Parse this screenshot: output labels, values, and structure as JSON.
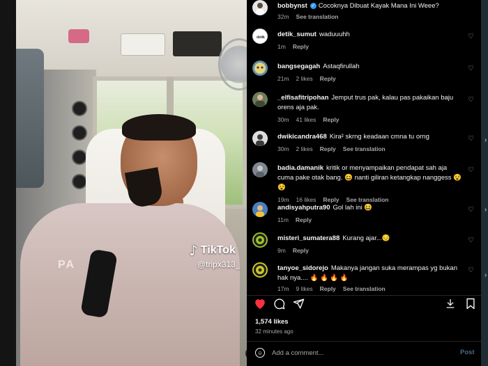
{
  "media": {
    "watermark_brand": "TikTok",
    "watermark_handle": "@tripx313_",
    "shirt_print": "PA",
    "mute_icon": "mute-icon"
  },
  "caption": {
    "username": "bobbynst",
    "text": "Cocoknya Dibuat Kayak Mana Ini Weee?",
    "time": "32m",
    "see_translation": "See translation"
  },
  "comments": [
    {
      "username": "detik_sumut",
      "text": "waduuuhh",
      "time": "1m",
      "likes": "",
      "reply": "Reply",
      "translation": "",
      "avatar_color": "#ffffff"
    },
    {
      "username": "bangsegagah",
      "text": "Astaqfirullah",
      "time": "21m",
      "likes": "2 likes",
      "reply": "Reply",
      "translation": "",
      "avatar_color": "#5f8fb0"
    },
    {
      "username": "_elfisafitripohan",
      "text": "Jemput trus pak, kalau pas pakaikan baju orens aja pak.",
      "time": "30m",
      "likes": "41 likes",
      "reply": "Reply",
      "translation": "",
      "avatar_color": "#6d7d5a"
    },
    {
      "username": "dwikicandra468",
      "text": "Kira² skrng keadaan cmna tu orng",
      "time": "30m",
      "likes": "2 likes",
      "reply": "Reply",
      "translation": "See translation",
      "avatar_color": "#dddddd"
    },
    {
      "username": "badia.damanik",
      "text": "kritik or menyampaikan pendapat sah aja cuma pake otak bang. 😆 nanti giliran ketangkap nanggess 😵 😵",
      "time": "19m",
      "likes": "16 likes",
      "reply": "Reply",
      "translation": "See translation",
      "avatar_color": "#7d8791"
    },
    {
      "username": "andisyahputra90",
      "text": "Gol lah ini 😆",
      "time": "11m",
      "likes": "",
      "reply": "Reply",
      "translation": "",
      "avatar_color": "#4b7fb8"
    },
    {
      "username": "misteri_sumatera88",
      "text": "Kurang ajar...😔",
      "time": "9m",
      "likes": "",
      "reply": "Reply",
      "translation": "",
      "avatar_color": "#9bbf2b"
    },
    {
      "username": "tanyoe_sidorejo",
      "text": "Makanya jangan suka merampas yg bukan hak nya.... 🔥 🔥 🔥 🔥",
      "time": "17m",
      "likes": "9 likes",
      "reply": "Reply",
      "translation": "See translation",
      "avatar_color": "#c9c82a"
    }
  ],
  "actions": {
    "like_icon": "heart-filled-icon",
    "comment_icon": "comment-icon",
    "share_icon": "share-icon",
    "save_icon": "bookmark-icon"
  },
  "likes_count": "1,574 likes",
  "posted_ago": "32 minutes ago",
  "comment_box": {
    "placeholder": "Add a comment...",
    "post_label": "Post"
  },
  "colors": {
    "like_red": "#ff3040",
    "verified_blue": "#3897f0",
    "post_disabled": "#4a6a85",
    "panel_bg": "#000000"
  }
}
